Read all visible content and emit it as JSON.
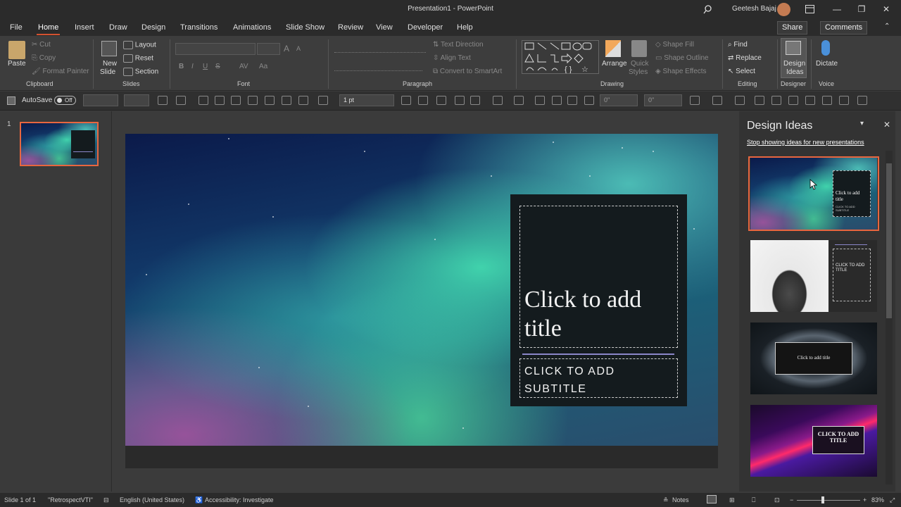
{
  "window": {
    "title": "Presentation1 - PowerPoint",
    "user": "Geetesh Bajaj",
    "minimize": "—",
    "restore": "❐",
    "close": "✕"
  },
  "tabs": [
    {
      "label": "File"
    },
    {
      "label": "Home"
    },
    {
      "label": "Insert"
    },
    {
      "label": "Draw"
    },
    {
      "label": "Design"
    },
    {
      "label": "Transitions"
    },
    {
      "label": "Animations"
    },
    {
      "label": "Slide Show"
    },
    {
      "label": "Review"
    },
    {
      "label": "View"
    },
    {
      "label": "Developer"
    },
    {
      "label": "Help"
    }
  ],
  "share": "Share",
  "comments": "Comments",
  "ribbon": {
    "clipboard": {
      "paste": "Paste",
      "cut": "Cut",
      "copy": "Copy",
      "format_painter": "Format Painter",
      "group": "Clipboard"
    },
    "slides": {
      "new_slide_1": "New",
      "new_slide_2": "Slide",
      "layout": "Layout",
      "reset": "Reset",
      "section": "Section",
      "group": "Slides"
    },
    "font": {
      "group": "Font",
      "bold": "B",
      "italic": "I",
      "underline": "U",
      "strike": "S",
      "spacing": "AV",
      "case": "Aa",
      "grow": "A",
      "shrink": "A"
    },
    "paragraph": {
      "group": "Paragraph",
      "text_direction": "Text Direction",
      "align_text": "Align Text",
      "smartart": "Convert to SmartArt"
    },
    "drawing": {
      "group": "Drawing",
      "arrange": "Arrange",
      "quick_styles_1": "Quick",
      "quick_styles_2": "Styles",
      "shape_fill": "Shape Fill",
      "shape_outline": "Shape Outline",
      "shape_effects": "Shape Effects"
    },
    "editing": {
      "group": "Editing",
      "find": "Find",
      "replace": "Replace",
      "select": "Select"
    },
    "designer": {
      "group": "Designer",
      "label_1": "Design",
      "label_2": "Ideas"
    },
    "voice": {
      "group": "Voice",
      "dictate": "Dictate"
    }
  },
  "qat": {
    "autosave": "AutoSave",
    "autosave_state": "Off",
    "line_weight": "1 pt",
    "size_h": "0\"",
    "size_w": "0\""
  },
  "thumbs": {
    "slide_number": "1"
  },
  "slide": {
    "title": "Click to add title",
    "subtitle": "CLICK TO ADD SUBTITLE"
  },
  "design_ideas": {
    "title": "Design Ideas",
    "stop_link": "Stop showing ideas for new presentations",
    "ideas": [
      {
        "title": "Click to add title",
        "subtitle": "CLICK TO ADD SUBTITLE"
      },
      {
        "title": "CLICK TO ADD TITLE"
      },
      {
        "title": "Click to add title"
      },
      {
        "title": "CLICK TO ADD TITLE"
      }
    ]
  },
  "status": {
    "slide": "Slide 1 of 1",
    "theme": "\"RetrospectVTI\"",
    "language": "English (United States)",
    "accessibility": "Accessibility: Investigate",
    "notes": "Notes",
    "zoom": "83%"
  },
  "colors": {
    "accent": "#d35230",
    "selection": "#e8663f"
  }
}
